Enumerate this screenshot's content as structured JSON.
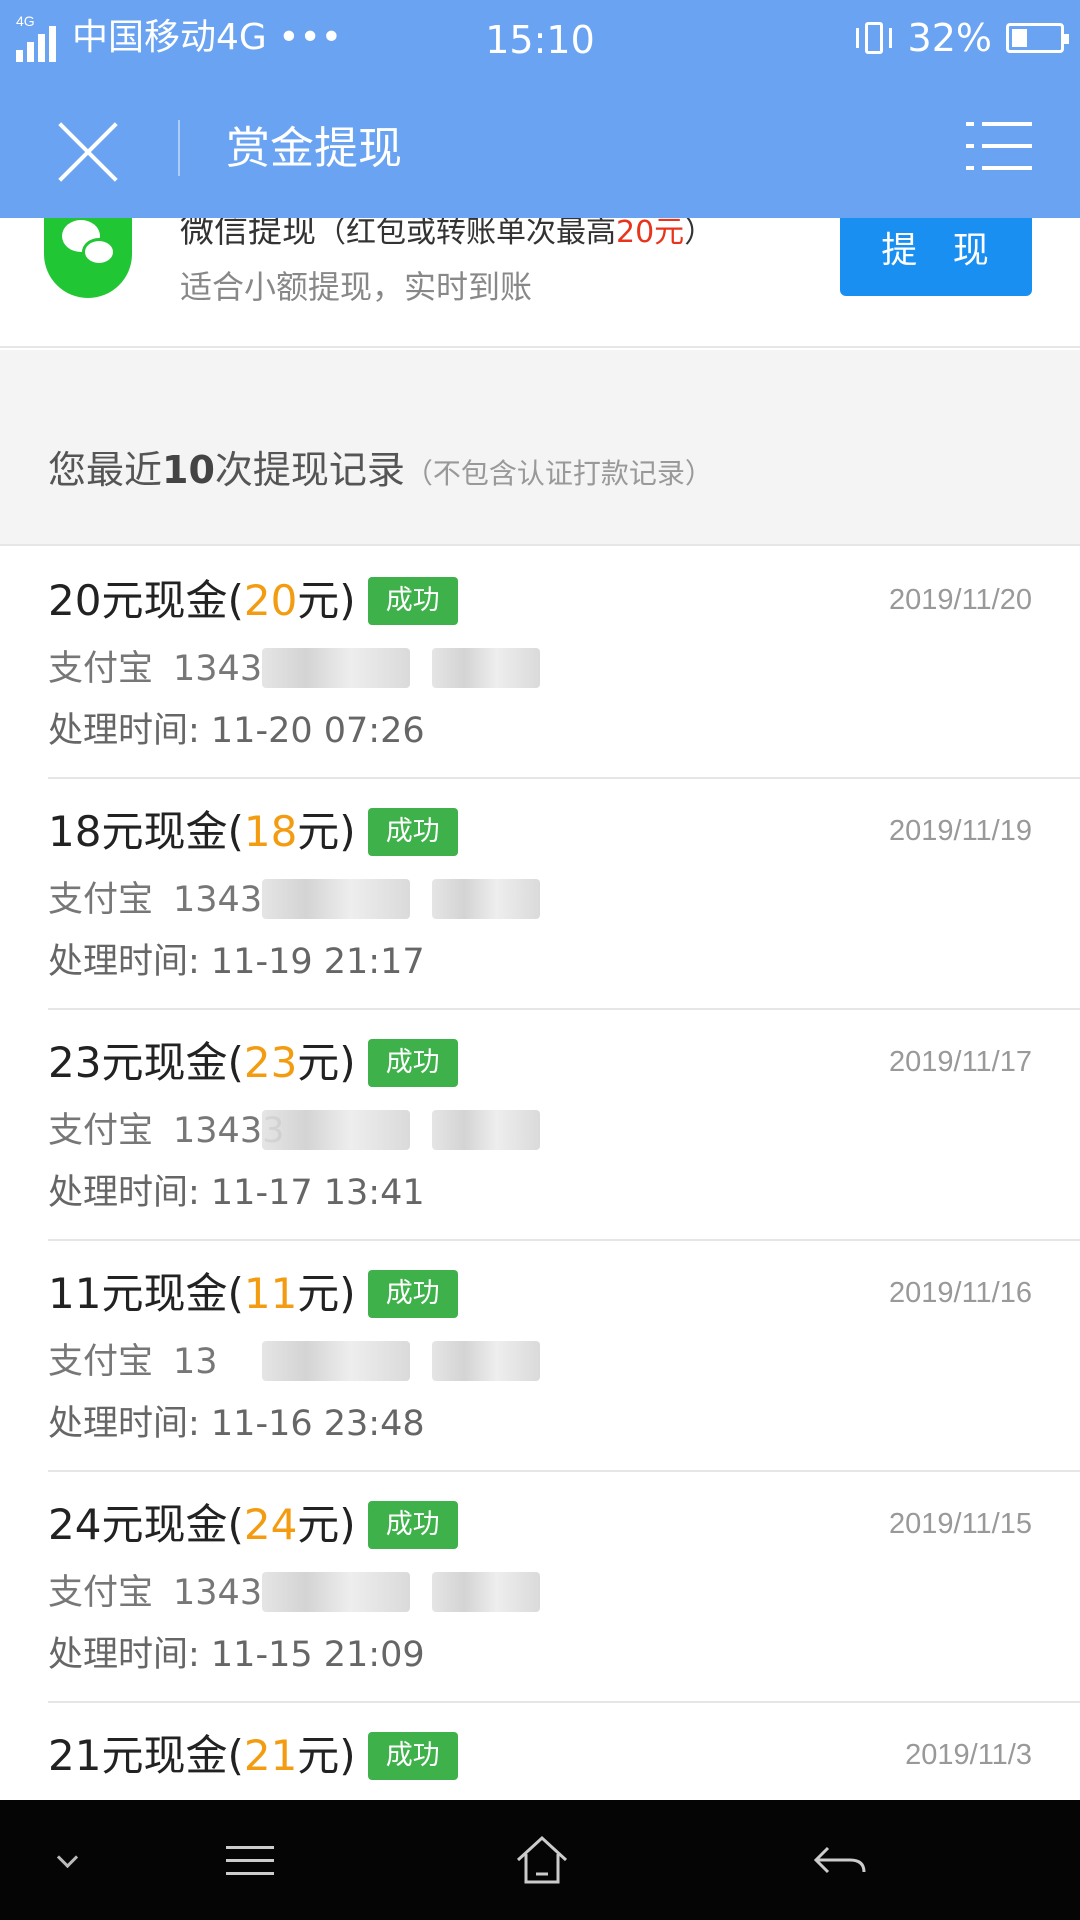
{
  "status_bar": {
    "network_badge": "4G",
    "carrier": "中国移动4G •••",
    "time": "15:10",
    "battery_percent": "32%",
    "battery_level": 0.32
  },
  "header": {
    "title": "赏金提现",
    "close_icon": "close-icon",
    "menu_icon": "menu-icon"
  },
  "wechat": {
    "title_main": "微信提现",
    "title_sub_prefix": "（红包或转账单次最高",
    "title_sub_highlight": "20元",
    "title_sub_suffix": "）",
    "description": "适合小额提现，实时到账",
    "button_label": "提 现",
    "accent_color": "#21c634"
  },
  "records_header": {
    "prefix": "您最近",
    "count": "10",
    "suffix": "次提现记录",
    "note": "（不包含认证打款记录）"
  },
  "records": [
    {
      "title": "20元现金(",
      "amount": "20",
      "title_end": "元)",
      "status": "成功",
      "date": "2019/11/20",
      "method": "支付宝",
      "account": "1343",
      "time": "处理时间: 11-20 07:26"
    },
    {
      "title": "18元现金(",
      "amount": "18",
      "title_end": "元)",
      "status": "成功",
      "date": "2019/11/19",
      "method": "支付宝",
      "account": "1343",
      "time": "处理时间: 11-19 21:17"
    },
    {
      "title": "23元现金(",
      "amount": "23",
      "title_end": "元)",
      "status": "成功",
      "date": "2019/11/17",
      "method": "支付宝",
      "account": "13433",
      "time": "处理时间: 11-17 13:41"
    },
    {
      "title": "11元现金(",
      "amount": "11",
      "title_end": "元)",
      "status": "成功",
      "date": "2019/11/16",
      "method": "支付宝",
      "account": "13",
      "time": "处理时间: 11-16 23:48"
    },
    {
      "title": "24元现金(",
      "amount": "24",
      "title_end": "元)",
      "status": "成功",
      "date": "2019/11/15",
      "method": "支付宝",
      "account": "1343",
      "time": "处理时间: 11-15 21:09"
    },
    {
      "title": "21元现金(",
      "amount": "21",
      "title_end": "元)",
      "status": "成功",
      "date": "2019/11/3",
      "method": "",
      "account": "",
      "time": ""
    }
  ],
  "colors": {
    "header_bg": "#6aa3f2",
    "button_blue": "#1a8ff2",
    "amount_orange": "#f39c12",
    "success_green": "#3eb14a",
    "highlight_red": "#e8341c"
  },
  "nav_bar": {
    "icons": [
      "chevron-down-icon",
      "menu-icon",
      "home-icon",
      "back-icon"
    ]
  }
}
